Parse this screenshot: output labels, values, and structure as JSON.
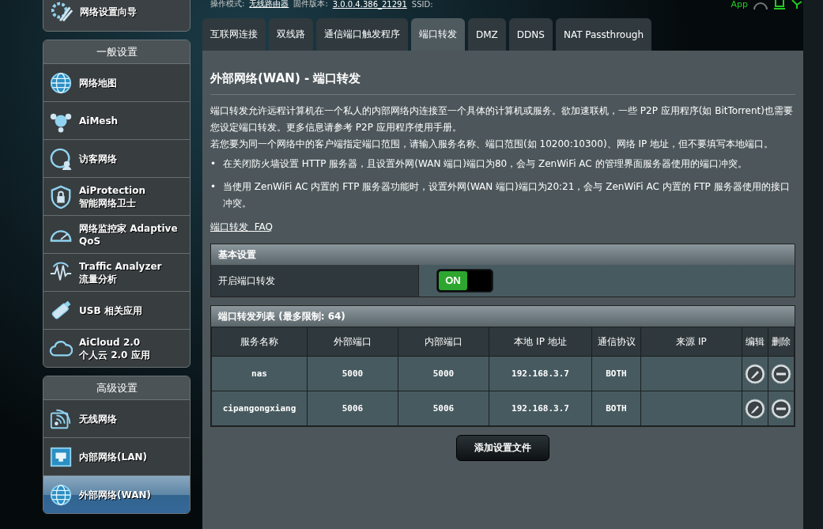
{
  "top_bar": {
    "items": [
      {
        "label": "操作模式:",
        "link": false
      },
      {
        "label": "无线路由器",
        "link": true
      },
      {
        "label": "固件版本:",
        "link": false
      },
      {
        "label": "3.0.0.4.386_21291",
        "link": true
      },
      {
        "label": "SSID:",
        "link": false
      }
    ],
    "app_label": "App"
  },
  "sidebar": {
    "wizard": {
      "label": "网络设置向导"
    },
    "sections": [
      {
        "title": "一般设置",
        "items": [
          {
            "label": "网络地图",
            "selected": false
          },
          {
            "label": "AiMesh",
            "selected": false
          },
          {
            "label": "访客网络",
            "selected": false
          },
          {
            "label": "AiProtection\n智能网络卫士",
            "selected": false
          },
          {
            "label": "网络监控家 Adaptive QoS",
            "selected": false
          },
          {
            "label": "Traffic Analyzer\n流量分析",
            "selected": false
          },
          {
            "label": "USB 相关应用",
            "selected": false
          },
          {
            "label": "AiCloud 2.0\n个人云 2.0 应用",
            "selected": false
          }
        ]
      },
      {
        "title": "高级设置",
        "items": [
          {
            "label": "无线网络",
            "selected": false
          },
          {
            "label": "内部网络(LAN)",
            "selected": false
          },
          {
            "label": "外部网络(WAN)",
            "selected": true
          }
        ]
      }
    ]
  },
  "tabs": [
    {
      "label": "互联网连接",
      "selected": false
    },
    {
      "label": "双线路",
      "selected": false
    },
    {
      "label": "通信端口触发程序",
      "selected": false
    },
    {
      "label": "端口转发",
      "selected": true
    },
    {
      "label": "DMZ",
      "selected": false
    },
    {
      "label": "DDNS",
      "selected": false
    },
    {
      "label": "NAT Passthrough",
      "selected": false
    }
  ],
  "page": {
    "title": "外部网络(WAN) - 端口转发",
    "intro": [
      "端口转发允许远程计算机在一个私人的内部网络内连接至一个具体的计算机或服务。欲加速联机，一些 P2P 应用程序(如 BitTorrent)也需要您设定端口转发。更多信息请参考 P2P 应用程序使用手册。",
      "若您要为同一个网络中的客户端指定端口范围，请输入服务名称、端口范围(如 10200:10300)、网络 IP 地址，但不要填写本地端口。"
    ],
    "bullets": [
      {
        "marker": "•",
        "text": "在关闭防火墙设置 HTTP 服务器，且设置外网(WAN 端口)端口为80，会与 ZenWiFi AC 的管理界面服务器使用的端口冲突。"
      },
      {
        "marker": "•",
        "text": "当使用 ZenWiFi AC 内置的 FTP 服务器功能时，设置外网(WAN 端口)端口为20:21，会与 ZenWiFi AC 内置的 FTP 服务器使用的接口冲突。"
      }
    ],
    "faq_link": "端口转发  FAQ"
  },
  "basic": {
    "title": "基本设置",
    "setting_label": "开启端口转发",
    "toggle": {
      "on": true,
      "on_label": "ON"
    }
  },
  "list": {
    "title": "端口转发列表 (最多限制: 64)",
    "columns": [
      "服务名称",
      "外部端口",
      "内部端口",
      "本地 IP 地址",
      "通信协议",
      "来源 IP",
      "编辑",
      "删除"
    ],
    "rows": [
      {
        "cells": [
          "nas",
          "5000",
          "5000",
          "192.168.3.7",
          "BOTH"
        ]
      },
      {
        "cells": [
          "cipangongxiang",
          "5006",
          "5006",
          "192.168.3.7",
          "BOTH"
        ]
      }
    ]
  },
  "add_button": "添加设置文件"
}
